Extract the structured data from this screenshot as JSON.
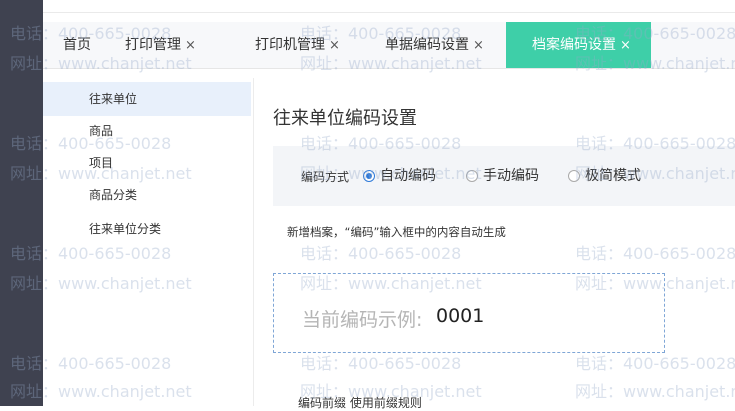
{
  "tabs": [
    {
      "label": "首页",
      "closable": false
    },
    {
      "label": "打印管理",
      "closable": true
    },
    {
      "label": "打印机管理",
      "closable": true
    },
    {
      "label": "单据编码设置",
      "closable": true
    },
    {
      "label": "档案编码设置",
      "closable": true,
      "active": true
    }
  ],
  "close_glyph": "×",
  "sidebar": {
    "items": [
      {
        "label": "往来单位",
        "active": true
      },
      {
        "label": "商品"
      },
      {
        "label": "项目"
      },
      {
        "label": "商品分类"
      },
      {
        "label": "往来单位分类"
      }
    ]
  },
  "main": {
    "title": "往来单位编码设置",
    "mode_label": "编码方式",
    "modes": [
      {
        "label": "自动编码",
        "selected": true
      },
      {
        "label": "手动编码",
        "selected": false
      },
      {
        "label": "极简模式",
        "selected": false
      }
    ],
    "note": "新增档案，“编码”输入框中的内容自动生成",
    "example_label": "当前编码示例:",
    "example_value": "0001",
    "bottom_partial": "编码前缀  使用前缀规则"
  },
  "watermark": {
    "phone": "电话：400-665-0028",
    "url": "网址：www.chanjet.net"
  },
  "colors": {
    "active_tab": "#3ecfa8",
    "sidebar_active": "#e8f0fb",
    "radio_on": "#2f7ad9",
    "dark_rail": "#3f4250"
  }
}
